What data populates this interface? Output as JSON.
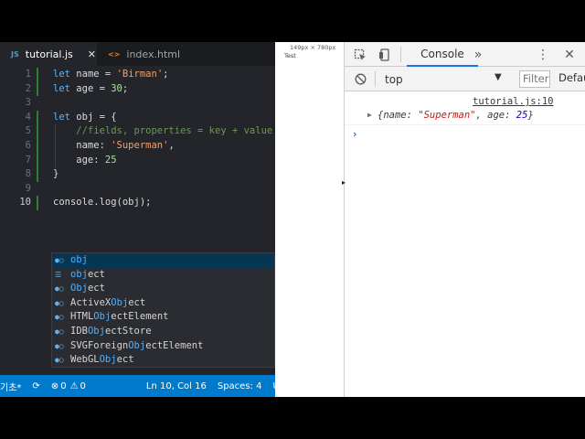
{
  "editor": {
    "tabs": [
      {
        "icon": "JS",
        "label": "tutorial.js",
        "close": "✕"
      },
      {
        "icon": "<>",
        "label": "index.html"
      }
    ],
    "lines": [
      {
        "n": "1",
        "parts": [
          {
            "c": "kw",
            "t": "let "
          },
          {
            "c": "",
            "t": "name = "
          },
          {
            "c": "str",
            "t": "'Birman'"
          },
          {
            "c": "",
            "t": ";"
          }
        ]
      },
      {
        "n": "2",
        "parts": [
          {
            "c": "kw",
            "t": "let "
          },
          {
            "c": "",
            "t": "age = "
          },
          {
            "c": "num",
            "t": "30"
          },
          {
            "c": "",
            "t": ";"
          }
        ]
      },
      {
        "n": "3",
        "parts": []
      },
      {
        "n": "4",
        "parts": [
          {
            "c": "kw",
            "t": "let "
          },
          {
            "c": "",
            "t": "obj = {"
          }
        ]
      },
      {
        "n": "5",
        "parts": [
          {
            "c": "com",
            "t": "    //fields, properties = key + value"
          }
        ]
      },
      {
        "n": "6",
        "parts": [
          {
            "c": "",
            "t": "    name: "
          },
          {
            "c": "str",
            "t": "'Superman'"
          },
          {
            "c": "",
            "t": ","
          }
        ]
      },
      {
        "n": "7",
        "parts": [
          {
            "c": "",
            "t": "    age: "
          },
          {
            "c": "num",
            "t": "25"
          }
        ]
      },
      {
        "n": "8",
        "parts": [
          {
            "c": "",
            "t": "}"
          }
        ]
      },
      {
        "n": "9",
        "parts": []
      },
      {
        "n": "10",
        "parts": [
          {
            "c": "",
            "t": "console.log(obj);"
          }
        ]
      }
    ],
    "suggestions": [
      {
        "icon": "●○",
        "match": "obj",
        "rest": "",
        "pre": ""
      },
      {
        "icon": "☰",
        "match": "obj",
        "rest": "ect",
        "pre": ""
      },
      {
        "icon": "●○",
        "match": "Obj",
        "rest": "ect",
        "pre": ""
      },
      {
        "icon": "●○",
        "pre": "ActiveX",
        "match": "Obj",
        "rest": "ect"
      },
      {
        "icon": "●○",
        "pre": "HTML",
        "match": "Obj",
        "rest": "ectElement"
      },
      {
        "icon": "●○",
        "pre": "IDB",
        "match": "Obj",
        "rest": "ectStore"
      },
      {
        "icon": "●○",
        "pre": "SVGForeign",
        "match": "Obj",
        "rest": "ectElement"
      },
      {
        "icon": "●○",
        "pre": "WebGL",
        "match": "Obj",
        "rest": "ect"
      }
    ],
    "status": {
      "branch": "기초*",
      "errors": "0",
      "warnings": "0",
      "position": "Ln 10, Col 16",
      "spaces": "Spaces: 4",
      "tail": "U"
    }
  },
  "viewport": {
    "dims": "149px × 780px",
    "page_text": "Test"
  },
  "devtools": {
    "tab_console": "Console",
    "more_tabs": "»",
    "context": "top",
    "filter_placeholder": "Filter",
    "levels": "Default",
    "source_link": "tutorial.js:10",
    "log_output": {
      "open": "{",
      "k1": "name",
      "v1": "\"Superman\"",
      "k2": "age",
      "v2": "25",
      "close": "}"
    },
    "prompt": "›"
  }
}
